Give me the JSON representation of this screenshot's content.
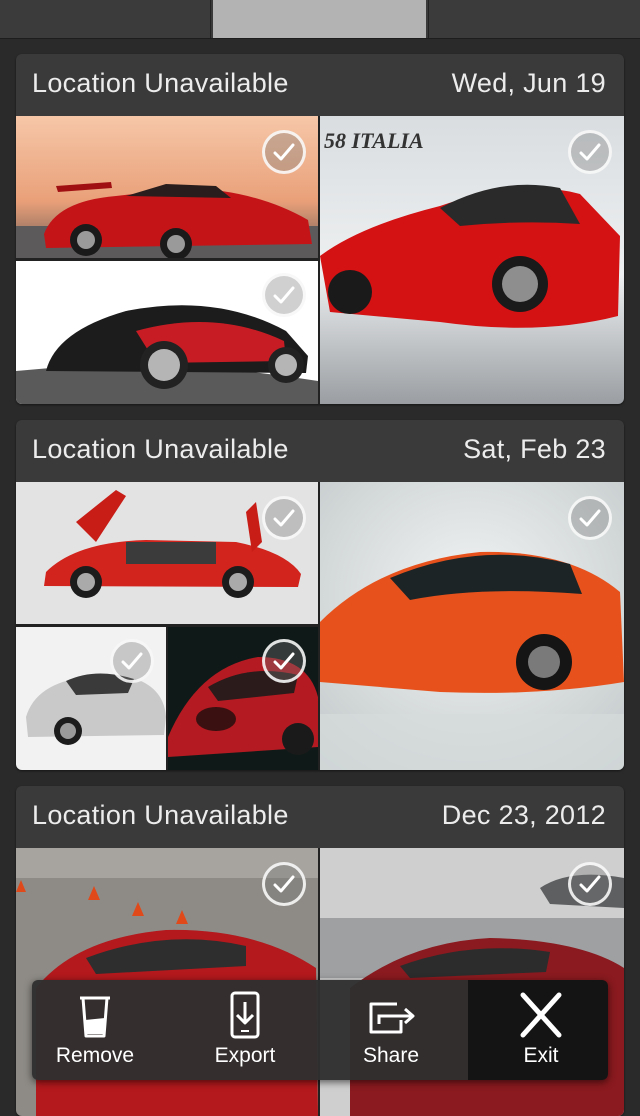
{
  "groups": [
    {
      "location": "Location Unavailable",
      "date": "Wed, Jun 19"
    },
    {
      "location": "Location Unavailable",
      "date": "Sat, Feb 23"
    },
    {
      "location": "Location Unavailable",
      "date": "Dec 23, 2012"
    }
  ],
  "photo_text": {
    "ferrari_badge": "58 ITALIA"
  },
  "toolbar": {
    "remove_label": "Remove",
    "export_label": "Export",
    "share_label": "Share",
    "exit_label": "Exit"
  },
  "icons": [
    "trash-icon",
    "export-icon",
    "share-icon",
    "close-icon",
    "checkmark-icon"
  ],
  "colors": {
    "background": "#2a2a2a",
    "card": "#3a3a3a",
    "tab_selected": "#b3b3b3",
    "text": "#ececec"
  }
}
